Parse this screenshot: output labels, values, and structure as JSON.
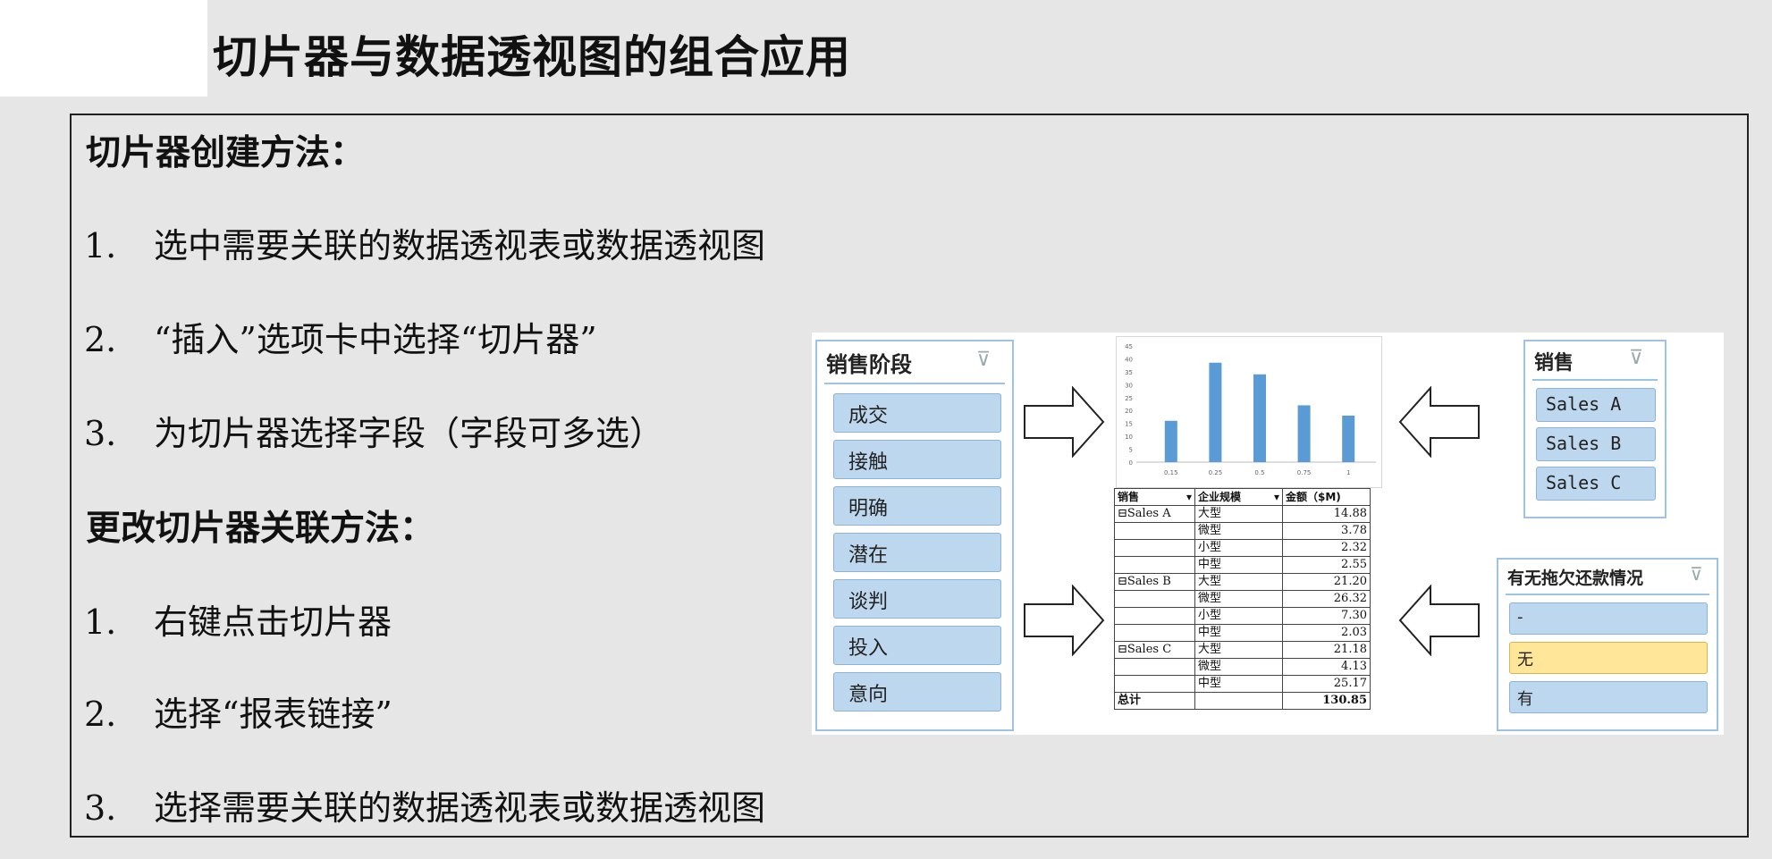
{
  "page": {
    "title": "切片器与数据透视图的组合应用",
    "section1": {
      "heading": "切片器创建方法：",
      "items": [
        {
          "num": "1.",
          "text": "选中需要关联的数据透视表或数据透视图"
        },
        {
          "num": "2.",
          "text": "“插入”选项卡中选择“切片器”"
        },
        {
          "num": "3.",
          "text": "为切片器选择字段（字段可多选）"
        }
      ]
    },
    "section2": {
      "heading": "更改切片器关联方法：",
      "items": [
        {
          "num": "1.",
          "text": "右键点击切片器"
        },
        {
          "num": "2.",
          "text": "选择“报表链接”"
        },
        {
          "num": "3.",
          "text": "选择需要关联的数据透视表或数据透视图"
        }
      ]
    }
  },
  "illustration": {
    "slicer_stage": {
      "title": "销售阶段",
      "items": [
        "成交",
        "接触",
        "明确",
        "潜在",
        "谈判",
        "投入",
        "意向"
      ]
    },
    "slicer_sales": {
      "title": "销售",
      "items": [
        "Sales A",
        "Sales B",
        "Sales C"
      ]
    },
    "slicer_debt": {
      "title": "有无拖欠还款情况",
      "items": [
        "-",
        "无",
        "有"
      ],
      "selected_index": 1
    },
    "pivot_table": {
      "headers": [
        "销售",
        "企业规模",
        "金额（$M)"
      ],
      "rows": [
        [
          "⊟Sales A",
          "大型",
          "14.88"
        ],
        [
          "",
          "微型",
          "3.78"
        ],
        [
          "",
          "小型",
          "2.32"
        ],
        [
          "",
          "中型",
          "2.55"
        ],
        [
          "⊟Sales B",
          "大型",
          "21.20"
        ],
        [
          "",
          "微型",
          "26.32"
        ],
        [
          "",
          "小型",
          "7.30"
        ],
        [
          "",
          "中型",
          "2.03"
        ],
        [
          "⊟Sales C",
          "大型",
          "21.18"
        ],
        [
          "",
          "微型",
          "4.13"
        ],
        [
          "",
          "中型",
          "25.17"
        ]
      ],
      "total": [
        "总计",
        "",
        "130.85"
      ]
    },
    "colors": {
      "slicer_button": "#bdd7ee",
      "slicer_selected": "#ffe699",
      "bar": "#5b9bd5"
    }
  },
  "chart_data": {
    "type": "bar",
    "categories": [
      "0.15",
      "0.25",
      "0.5",
      "0.75",
      "1"
    ],
    "values": [
      16,
      38.5,
      34,
      22,
      18
    ],
    "ylim": [
      0,
      45
    ],
    "yticks": [
      0,
      5,
      10,
      15,
      20,
      25,
      30,
      35,
      40,
      45
    ],
    "grid": false
  }
}
